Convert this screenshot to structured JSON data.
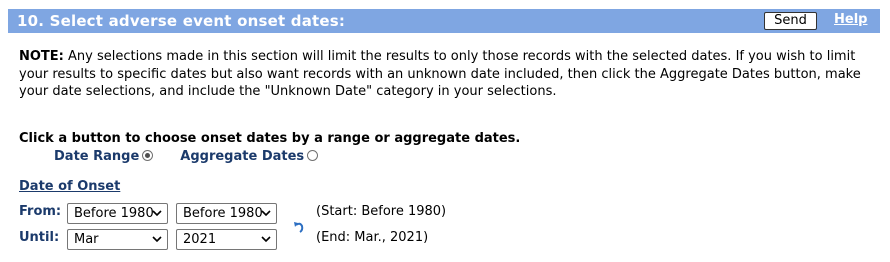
{
  "header": {
    "title": "10. Select adverse event onset dates:",
    "send_label": "Send",
    "help_label": "Help",
    "background_color": "#7fa6e2"
  },
  "note": {
    "label": "NOTE:",
    "text": " Any selections made in this section will limit the results to only those records with the selected dates. If you wish to limit your results to specific dates but also want records with an unknown date included, then click the Aggregate Dates button, make your date selections, and include the \"Unknown Date\" category in your selections."
  },
  "choose": {
    "text": "Click a button to choose onset dates by a range or aggregate dates.",
    "options": [
      {
        "label": "Date Range",
        "selected": true
      },
      {
        "label": "Aggregate Dates",
        "selected": false
      }
    ]
  },
  "date_of_onset": {
    "title": "Date of Onset",
    "from": {
      "label": "From:",
      "month": "Before 1980",
      "year": "Before 1980",
      "info": "(Start: Before 1980)"
    },
    "until": {
      "label": "Until:",
      "month": "Mar",
      "year": "2021",
      "info": "(End: Mar., 2021)"
    },
    "reset_icon": "undo-arrow-icon"
  }
}
